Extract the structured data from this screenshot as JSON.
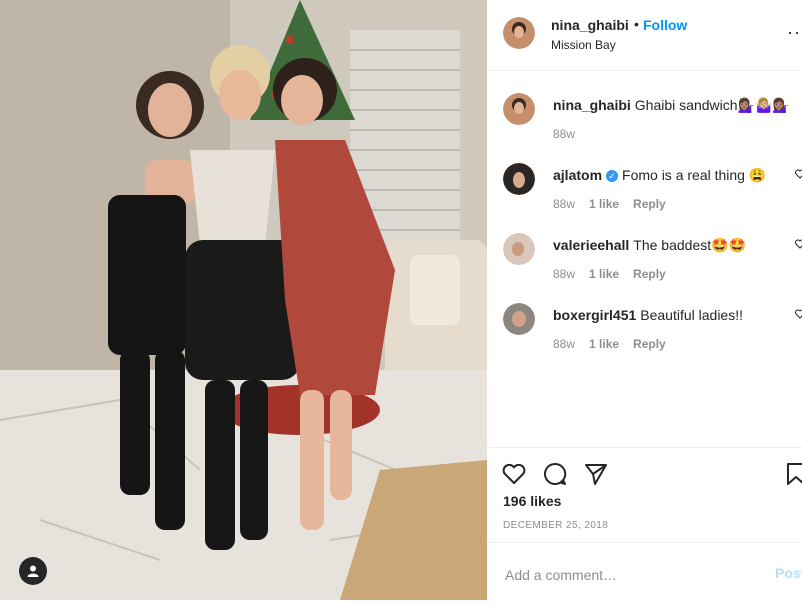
{
  "post": {
    "author": "nina_ghaibi",
    "follow_label": "Follow",
    "dot": "•",
    "location": "Mission Bay",
    "more": "···"
  },
  "comments": [
    {
      "user": "nina_ghaibi",
      "text": "Ghaibi sandwich💁🏽‍♀️🤷🏼‍♀️💁🏽‍♀️",
      "age": "88w",
      "likes": "",
      "reply": ""
    },
    {
      "user": "ajlatom",
      "verified": true,
      "text": "Fomo is a real thing 😩",
      "age": "88w",
      "likes": "1 like",
      "reply": "Reply"
    },
    {
      "user": "valerieehall",
      "text": "The baddest🤩🤩",
      "age": "88w",
      "likes": "1 like",
      "reply": "Reply"
    },
    {
      "user": "boxergirl451",
      "text": "Beautiful ladies!!",
      "age": "88w",
      "likes": "1 like",
      "reply": "Reply"
    }
  ],
  "engagement": {
    "likes": "196 likes",
    "date": "DECEMBER 25, 2018"
  },
  "comment_box": {
    "placeholder": "Add a comment…",
    "post_label": "Post"
  },
  "icons": [
    "user-tag-icon",
    "heart-icon",
    "comment-icon",
    "share-icon",
    "bookmark-icon",
    "more-icon",
    "verified-badge-icon"
  ],
  "colors": {
    "accent": "#0095f6",
    "verified": "#3897f0",
    "post_disabled": "#b2dffc",
    "muted": "#8e8e8e"
  }
}
